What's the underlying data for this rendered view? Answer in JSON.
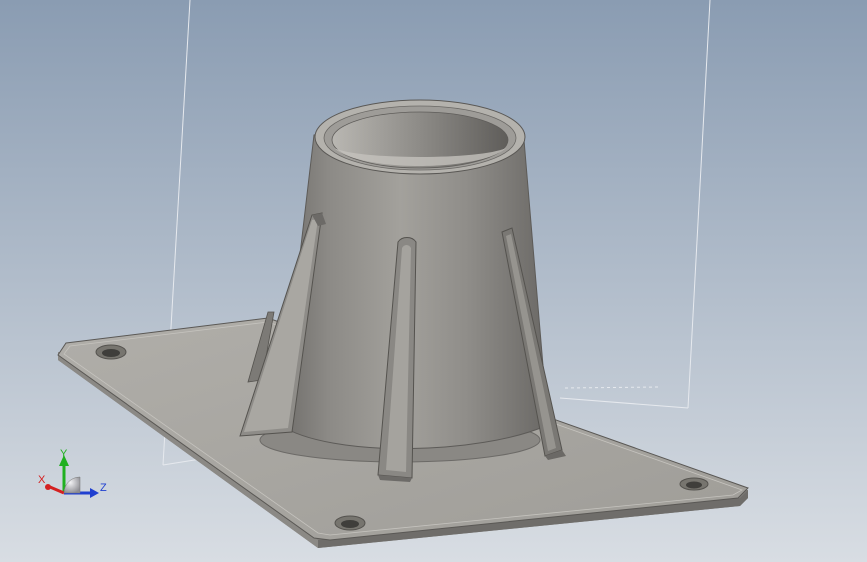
{
  "viewport": {
    "background_top": "#8a9cb2",
    "background_bottom": "#d8dde3"
  },
  "model": {
    "part_color": "#9c9a96",
    "plate_top_color": "#a8a6a1",
    "edge_color": "#5a5855"
  },
  "triad": {
    "x_label": "X",
    "y_label": "Y",
    "z_label": "Z",
    "x_color": "#d42020",
    "y_color": "#20b020",
    "z_color": "#2040d0",
    "sphere_color": "#c8c8cc"
  }
}
